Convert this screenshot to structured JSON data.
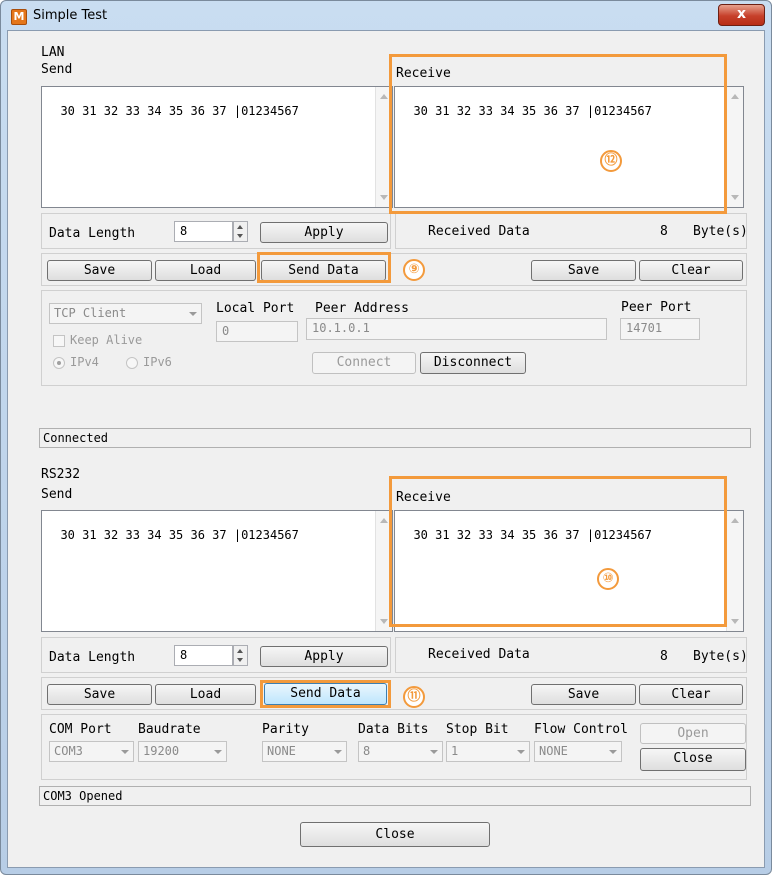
{
  "window": {
    "title": "Simple Test",
    "app_icon_letter": "M",
    "close_glyph": "x"
  },
  "lan": {
    "group_label": "LAN",
    "send_label": "Send",
    "receive_label": "Receive",
    "send_text": "30 31 32 33 34 35 36 37 |01234567",
    "receive_text": "30 31 32 33 34 35 36 37 |01234567",
    "data_length_label": "Data Length",
    "data_length_value": "8",
    "apply_label": "Apply",
    "received_data_label": "Received Data",
    "received_count": "8",
    "bytes_label": "Byte(s)",
    "save_label": "Save",
    "load_label": "Load",
    "send_data_label": "Send Data",
    "rx_save_label": "Save",
    "clear_label": "Clear",
    "mode_value": "TCP Client",
    "local_port_label": "Local Port",
    "local_port_value": "0",
    "peer_address_label": "Peer Address",
    "peer_address_value": "10.1.0.1",
    "peer_port_label": "Peer Port",
    "peer_port_value": "14701",
    "keep_alive_label": "Keep Alive",
    "ipv4_label": "IPv4",
    "ipv6_label": "IPv6",
    "connect_label": "Connect",
    "disconnect_label": "Disconnect",
    "status_text": "Connected"
  },
  "rs232": {
    "group_label": "RS232",
    "send_label": "Send",
    "receive_label": "Receive",
    "send_text": "30 31 32 33 34 35 36 37 |01234567",
    "receive_text": "30 31 32 33 34 35 36 37 |01234567",
    "data_length_label": "Data Length",
    "data_length_value": "8",
    "apply_label": "Apply",
    "received_data_label": "Received Data",
    "received_count": "8",
    "bytes_label": "Byte(s)",
    "save_label": "Save",
    "load_label": "Load",
    "send_data_label": "Send Data",
    "rx_save_label": "Save",
    "clear_label": "Clear",
    "com_port_label": "COM Port",
    "com_port_value": "COM3",
    "baudrate_label": "Baudrate",
    "baudrate_value": "19200",
    "parity_label": "Parity",
    "parity_value": "NONE",
    "data_bits_label": "Data Bits",
    "data_bits_value": "8",
    "stop_bit_label": "Stop Bit",
    "stop_bit_value": "1",
    "flow_control_label": "Flow Control",
    "flow_control_value": "NONE",
    "open_label": "Open",
    "close_port_label": "Close",
    "status_text": "COM3 Opened"
  },
  "footer": {
    "close_label": "Close"
  },
  "callouts": {
    "c9": "⑨",
    "c10": "⑩",
    "c11": "⑪",
    "c12": "⑫"
  },
  "colors": {
    "highlight": "#f39a3c",
    "title_bar": "#c9ddf1",
    "close_button": "#c6402a"
  }
}
